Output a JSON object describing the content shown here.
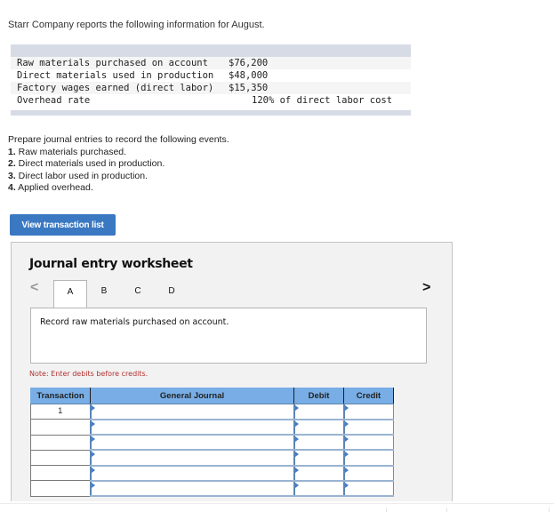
{
  "intro": "Starr Company reports the following information for August.",
  "info_rows": [
    {
      "label": "Raw materials purchased on account",
      "value": "$76,200"
    },
    {
      "label": "Direct materials used in production",
      "value": "$48,000"
    },
    {
      "label": "Factory wages earned (direct labor)",
      "value": "$15,350"
    },
    {
      "label": "Overhead rate",
      "value": "120% of direct labor cost"
    }
  ],
  "instructions": {
    "lead": "Prepare journal entries to record the following events.",
    "items": [
      {
        "num": "1.",
        "text": " Raw materials purchased."
      },
      {
        "num": "2.",
        "text": " Direct materials used in production."
      },
      {
        "num": "3.",
        "text": " Direct labor used in production."
      },
      {
        "num": "4.",
        "text": " Applied overhead."
      }
    ]
  },
  "view_button": "View transaction list",
  "worksheet": {
    "title": "Journal entry worksheet",
    "prev_icon": "chevron-left-icon",
    "next_icon": "chevron-right-icon",
    "prev_glyph": "<",
    "next_glyph": ">",
    "tabs": [
      "A",
      "B",
      "C",
      "D"
    ],
    "active_tab": "A",
    "description": "Record raw materials purchased on account.",
    "note": "Note: Enter debits before credits.",
    "table": {
      "headers": [
        "Transaction",
        "General Journal",
        "Debit",
        "Credit"
      ],
      "rows": [
        {
          "transaction": "1",
          "account": "",
          "debit": "",
          "credit": ""
        },
        {
          "transaction": "",
          "account": "",
          "debit": "",
          "credit": ""
        },
        {
          "transaction": "",
          "account": "",
          "debit": "",
          "credit": ""
        },
        {
          "transaction": "",
          "account": "",
          "debit": "",
          "credit": ""
        },
        {
          "transaction": "",
          "account": "",
          "debit": "",
          "credit": ""
        },
        {
          "transaction": "",
          "account": "",
          "debit": "",
          "credit": ""
        }
      ]
    }
  },
  "colors": {
    "button_blue": "#3a78c2",
    "table_header_blue": "#78aee5",
    "note_red": "#b33030",
    "info_band": "#d6dbe6"
  }
}
